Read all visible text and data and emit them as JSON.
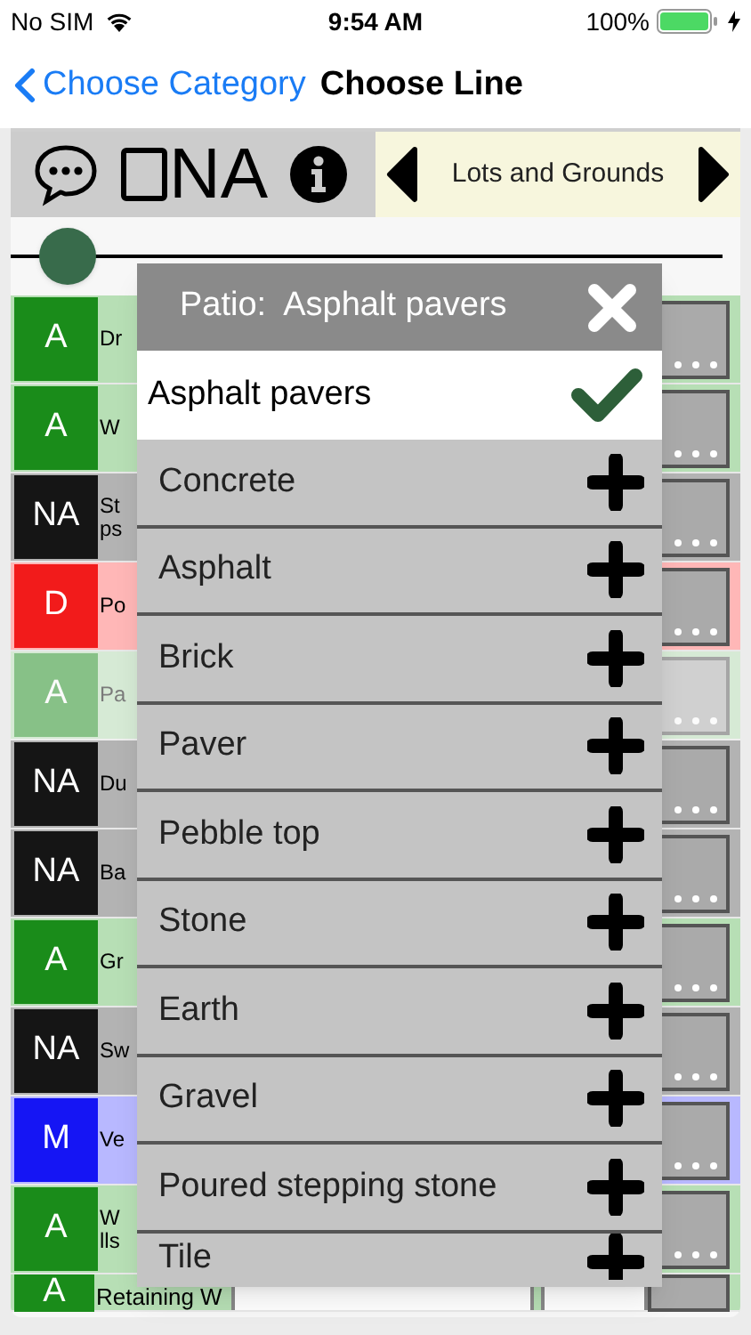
{
  "status_bar": {
    "carrier": "No SIM",
    "time": "9:54 AM",
    "battery": "100%"
  },
  "nav": {
    "back": "Choose Category",
    "title": "Choose Line"
  },
  "toolbar": {
    "na_checkbox": {
      "label": "NA",
      "checked": false
    },
    "category": "Lots and Grounds"
  },
  "slider": {
    "level": 0.05
  },
  "rows": [
    {
      "rating": "A",
      "kind": "good",
      "label": "Dr",
      "dimmed": false
    },
    {
      "rating": "A",
      "kind": "good",
      "label": "W",
      "dimmed": false
    },
    {
      "rating": "NA",
      "kind": "na",
      "label": "St ps",
      "dimmed": false
    },
    {
      "rating": "D",
      "kind": "defect",
      "label": "Po",
      "dimmed": false
    },
    {
      "rating": "A",
      "kind": "good",
      "label": "Pa",
      "dimmed": true
    },
    {
      "rating": "NA",
      "kind": "na",
      "label": "Du",
      "dimmed": false
    },
    {
      "rating": "NA",
      "kind": "na",
      "label": "Ba",
      "dimmed": false
    },
    {
      "rating": "A",
      "kind": "good",
      "label": "Gr",
      "dimmed": false
    },
    {
      "rating": "NA",
      "kind": "na",
      "label": "Sw",
      "dimmed": false
    },
    {
      "rating": "M",
      "kind": "monitor",
      "label": "Ve",
      "dimmed": false
    },
    {
      "rating": "A",
      "kind": "good",
      "label": "W lls",
      "dimmed": false
    },
    {
      "rating": "A",
      "kind": "good",
      "label": "Retaining W",
      "dimmed": false
    }
  ],
  "popup": {
    "title": "Patio:  Asphalt pavers",
    "options": [
      {
        "label": "Asphalt pavers",
        "selected": true
      },
      {
        "label": "Concrete",
        "selected": false
      },
      {
        "label": "Asphalt",
        "selected": false
      },
      {
        "label": "Brick",
        "selected": false
      },
      {
        "label": "Paver",
        "selected": false
      },
      {
        "label": "Pebble top",
        "selected": false
      },
      {
        "label": "Stone",
        "selected": false
      },
      {
        "label": "Earth",
        "selected": false
      },
      {
        "label": "Gravel",
        "selected": false
      },
      {
        "label": "Poured stepping stone",
        "selected": false
      },
      {
        "label": "Tile",
        "selected": false
      }
    ]
  }
}
